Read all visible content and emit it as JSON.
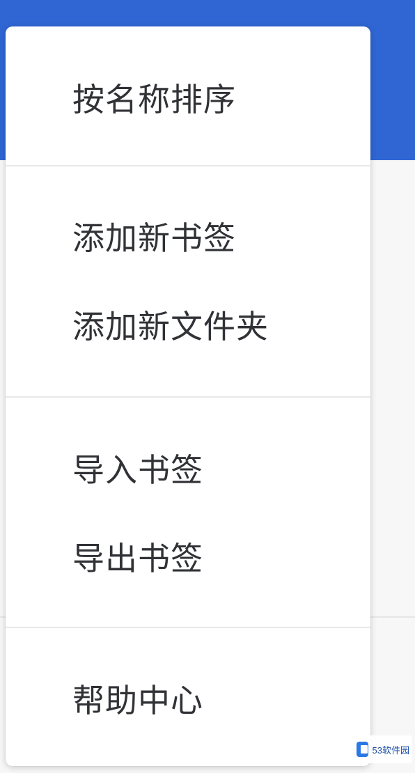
{
  "menu": {
    "items": [
      {
        "label": "按名称排序"
      },
      {
        "label": "添加新书签"
      },
      {
        "label": "添加新文件夹"
      },
      {
        "label": "导入书签"
      },
      {
        "label": "导出书签"
      },
      {
        "label": "帮助中心"
      }
    ]
  },
  "watermark": {
    "text": "53软件园",
    "logo_icon": "site-logo-icon"
  },
  "colors": {
    "header_blue": "#2f66d3",
    "menu_background": "#ffffff",
    "menu_text": "#303236",
    "divider": "#e8e8ea"
  }
}
